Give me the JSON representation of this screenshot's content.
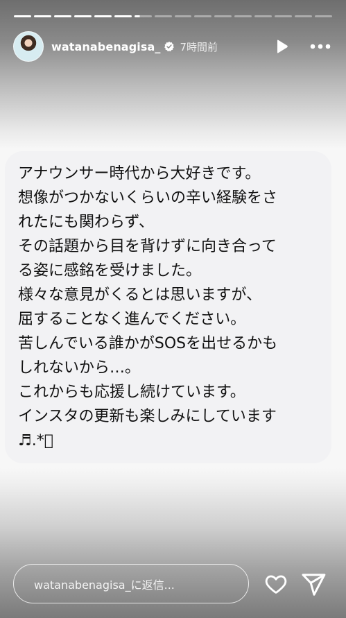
{
  "story": {
    "segments_total": 16,
    "segments_completed": 6,
    "current_segment_progress": 0.3
  },
  "header": {
    "username": "watanabenagisa_",
    "time_ago": "7時間前",
    "verified_icon": "verified-badge-icon",
    "play_icon": "play-icon",
    "more_icon": "more-horizontal-icon"
  },
  "message": {
    "lines": [
      "アナウンサー時代から大好きです。",
      "想像がつかないくらいの辛い経験をさ",
      "れたにも関わらず、",
      "その話題から目を背けずに向き合って",
      "る姿に感銘を受けました。",
      "様々な意見がくるとは思いますが、",
      "屈することなく進んでください。",
      "苦しんでいる誰かがSOSを出せるかも",
      "しれないから…。",
      "これからも応援し続けています。",
      "インスタの更新も楽しみにしています",
      "♬.*゚"
    ]
  },
  "footer": {
    "reply_placeholder": "watanabenagisa_に返信...",
    "heart_icon": "heart-icon",
    "send_icon": "send-icon"
  }
}
